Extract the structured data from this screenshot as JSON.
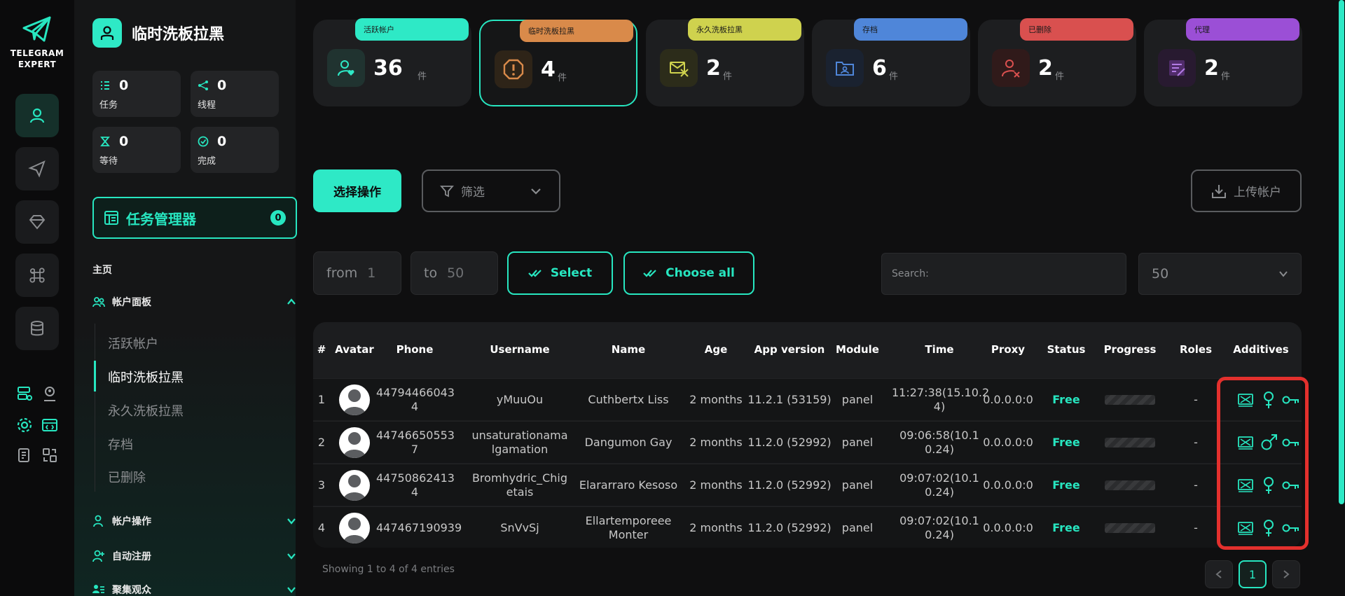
{
  "rail": {
    "logo_line1": "TELEGRAM",
    "logo_line2": "EXPERT"
  },
  "sidebar": {
    "title": "临时洗板拉黑",
    "stats": [
      {
        "value": "0",
        "label": "任务",
        "icon": "list-icon"
      },
      {
        "value": "0",
        "label": "线程",
        "icon": "share-icon"
      },
      {
        "value": "0",
        "label": "等待",
        "icon": "hourglass-icon"
      },
      {
        "value": "0",
        "label": "完成",
        "icon": "check-circle-icon"
      }
    ],
    "task_manager": {
      "label": "任务管理器",
      "count": "0"
    },
    "home_label": "主页",
    "sections": [
      {
        "label": "帐户面板"
      },
      {
        "label": "帐户操作"
      },
      {
        "label": "自动注册"
      },
      {
        "label": "聚集观众"
      }
    ],
    "sub_items": [
      "活跃帐户",
      "临时洗板拉黑",
      "永久洗板拉黑",
      "存档",
      "已删除"
    ]
  },
  "cards": [
    {
      "tag": "活跃帐户",
      "value": "36",
      "unit": "件",
      "color": "#2ee9c6"
    },
    {
      "tag": "临时洗板拉黑",
      "value": "4",
      "unit": "件",
      "color": "#d98a4a"
    },
    {
      "tag": "永久洗板拉黑",
      "value": "2",
      "unit": "件",
      "color": "#cfd24e"
    },
    {
      "tag": "存档",
      "value": "6",
      "unit": "件",
      "color": "#4f86d9"
    },
    {
      "tag": "已删除",
      "value": "2",
      "unit": "件",
      "color": "#d9504f"
    },
    {
      "tag": "代理",
      "value": "2",
      "unit": "件",
      "color": "#9b4fd6"
    }
  ],
  "toolbar": {
    "select_ops": "选择操作",
    "filter": "筛选",
    "upload": "上传帐户"
  },
  "range": {
    "from_label": "from",
    "from_value": "1",
    "to_label": "to",
    "to_value": "50",
    "select": "Select",
    "choose_all": "Choose all"
  },
  "search": {
    "placeholder": "Search:"
  },
  "page_size": "50",
  "table": {
    "headers": [
      "#",
      "Avatar",
      "Phone",
      "Username",
      "Name",
      "Age",
      "App version",
      "Module",
      "Time",
      "Proxy",
      "Status",
      "Progress",
      "Roles",
      "Additives"
    ],
    "rows": [
      {
        "num": "1",
        "phone": [
          "44794466043",
          "4"
        ],
        "username": [
          "yMuuOu"
        ],
        "name": [
          "Cuthbertx Liss"
        ],
        "age": "2 months",
        "app": "11.2.1 (53159)",
        "module": "panel",
        "time": [
          "11:27:38(15.10.2",
          "4)"
        ],
        "proxy": "0.0.0.0:0",
        "status": "Free",
        "roles": "-",
        "gender": "female"
      },
      {
        "num": "2",
        "phone": [
          "44746650553",
          "7"
        ],
        "username": [
          "unsaturationama",
          "lgamation"
        ],
        "name": [
          "Dangumon Gay"
        ],
        "age": "2 months",
        "app": "11.2.0 (52992)",
        "module": "panel",
        "time": [
          "09:06:58(10.1",
          "0.24)"
        ],
        "proxy": "0.0.0.0:0",
        "status": "Free",
        "roles": "-",
        "gender": "male"
      },
      {
        "num": "3",
        "phone": [
          "44750862413",
          "4"
        ],
        "username": [
          "Bromhydric_Chig",
          "etais"
        ],
        "name": [
          "Elararraro Kesoso"
        ],
        "age": "2 months",
        "app": "11.2.0 (52992)",
        "module": "panel",
        "time": [
          "09:07:02(10.1",
          "0.24)"
        ],
        "proxy": "0.0.0.0:0",
        "status": "Free",
        "roles": "-",
        "gender": "female"
      },
      {
        "num": "4",
        "phone": [
          "447467190939"
        ],
        "username": [
          "SnVvSj"
        ],
        "name": [
          "Ellartemporeee",
          "Monter"
        ],
        "age": "2 months",
        "app": "11.2.0 (52992)",
        "module": "panel",
        "time": [
          "09:07:02(10.1",
          "0.24)"
        ],
        "proxy": "0.0.0.0:0",
        "status": "Free",
        "roles": "-",
        "gender": "female"
      }
    ]
  },
  "footer": {
    "info": "Showing 1 to 4 of 4 entries",
    "page": "1"
  }
}
